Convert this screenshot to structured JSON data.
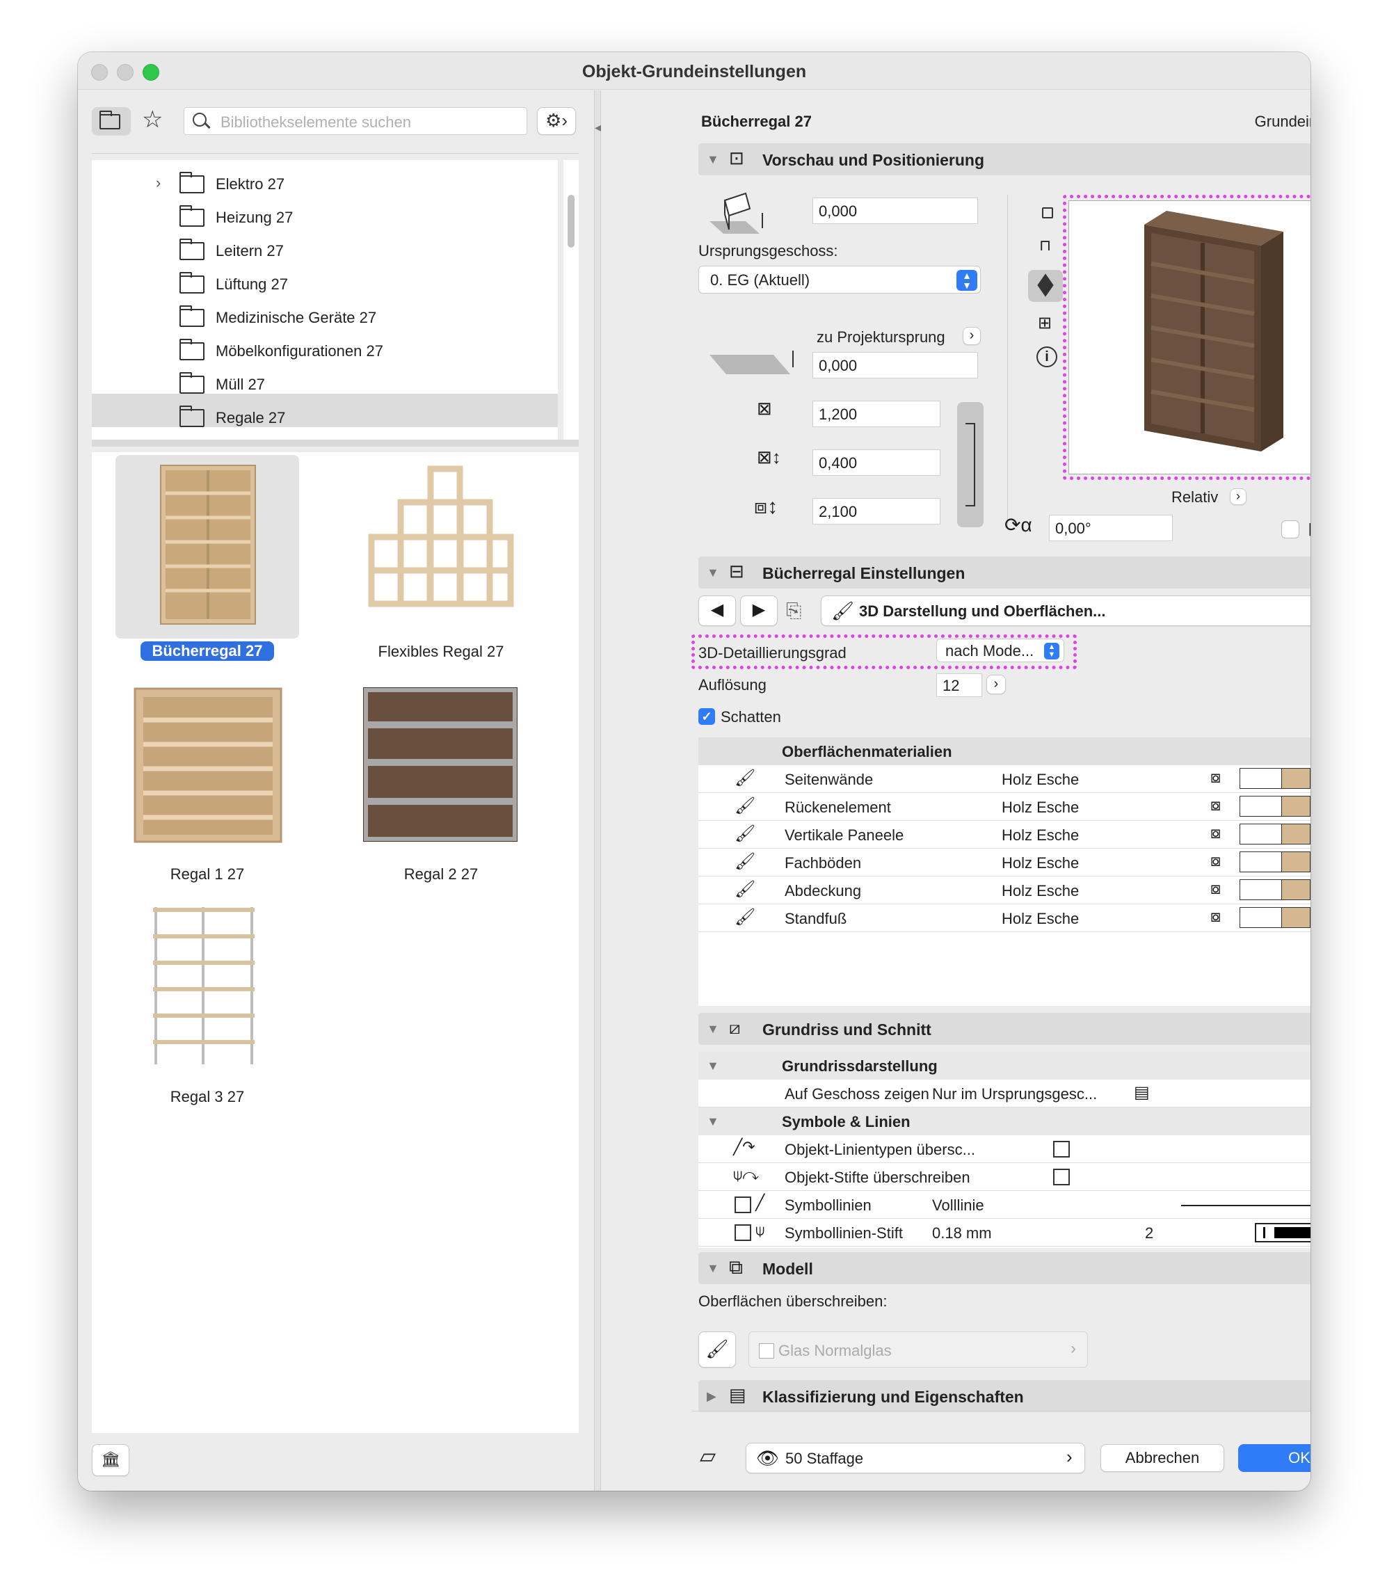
{
  "window": {
    "title": "Objekt-Grundeinstellungen"
  },
  "left": {
    "search_placeholder": "Bibliothekselemente suchen",
    "folders": [
      "Elektro 27",
      "Heizung 27",
      "Leitern 27",
      "Lüftung 27",
      "Medizinische Geräte 27",
      "Möbelkonfigurationen 27",
      "Müll 27",
      "Regale 27"
    ],
    "items": [
      "Bücherregal 27",
      "Flexibles Regal 27",
      "Regal 1 27",
      "Regal 2 27",
      "Regal 3 27"
    ]
  },
  "right": {
    "object_name": "Bücherregal 27",
    "default_label": "Grundeinstellung",
    "sections": {
      "preview": "Vorschau und Positionierung",
      "settings": "Bücherregal Einstellungen",
      "floorplan": "Grundriss und Schnitt",
      "model": "Modell",
      "classification": "Klassifizierung und Eigenschaften"
    },
    "preview": {
      "elevation_value": "0,000",
      "home_story_label": "Ursprungsgeschoss:",
      "home_story_value": "0. EG (Aktuell)",
      "relative_label": "zu Projektursprung",
      "relative_value": "0,000",
      "width": "1,200",
      "depth": "0,400",
      "height": "2,100",
      "relativ_label": "Relativ",
      "angle": "0,00°"
    },
    "settings": {
      "page_label": "3D Darstellung und Oberflächen...",
      "detail_label": "3D-Detaillierungsgrad",
      "detail_value": "nach Mode...",
      "resolution_label": "Auflösung",
      "resolution_value": "12",
      "shadow_label": "Schatten",
      "surfaces_header": "Oberflächenmaterialien",
      "surfaces": [
        {
          "name": "Seitenwände",
          "material": "Holz Esche"
        },
        {
          "name": "Rückenelement",
          "material": "Holz Esche"
        },
        {
          "name": "Vertikale Paneele",
          "material": "Holz Esche"
        },
        {
          "name": "Fachböden",
          "material": "Holz Esche"
        },
        {
          "name": "Abdeckung",
          "material": "Holz Esche"
        },
        {
          "name": "Standfuß",
          "material": "Holz Esche"
        }
      ]
    },
    "floorplan": {
      "group1": "Grundrissdarstellung",
      "show_on_story_label": "Auf Geschoss zeigen",
      "show_on_story_value": "Nur im Ursprungsgesc...",
      "group2": "Symbole & Linien",
      "override_linetypes": "Objekt-Linientypen übersc...",
      "override_pens": "Objekt-Stifte überschreiben",
      "symbol_lines": "Symbollinien",
      "symbol_lines_value": "Volllinie",
      "symbol_pen": "Symbollinien-Stift",
      "symbol_pen_value": "0.18 mm",
      "symbol_pen_number": "2"
    },
    "model": {
      "override_label": "Oberflächen überschreiben:",
      "surface_value": "Glas Normalglas"
    },
    "footer": {
      "layer": "50 Staffage",
      "cancel": "Abbrechen",
      "ok": "OK"
    }
  },
  "colors": {
    "accent": "#2f7cf6",
    "highlight": "#e040e8",
    "wood": "#d5b892",
    "dark_wood": "#5a4330"
  }
}
